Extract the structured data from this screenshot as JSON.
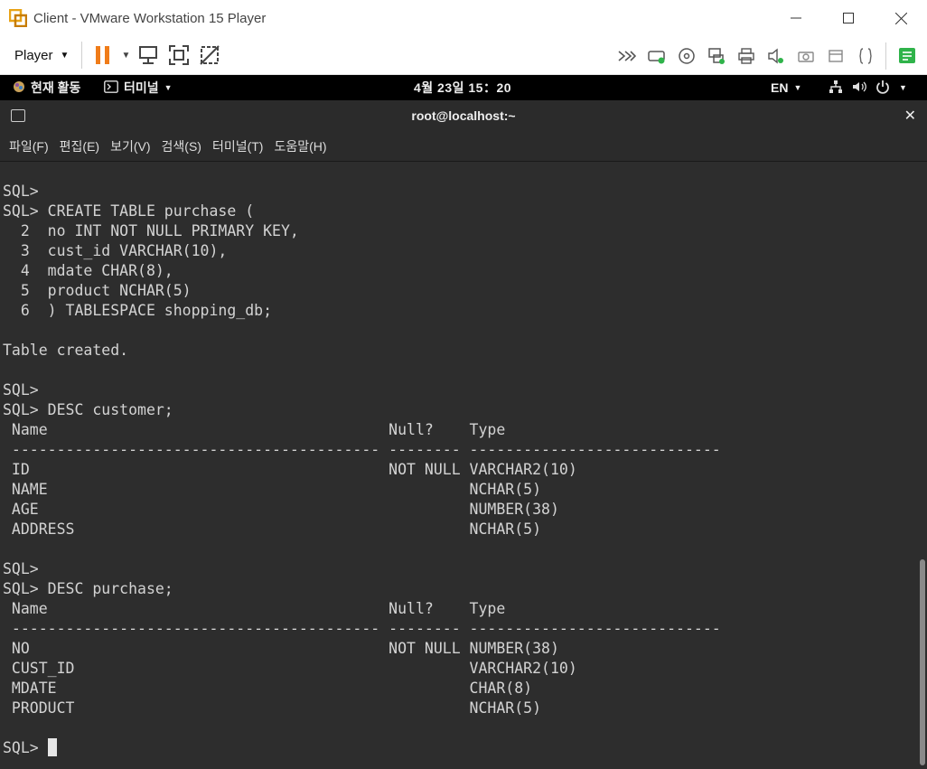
{
  "window": {
    "title": "Client - VMware Workstation 15 Player"
  },
  "toolbar": {
    "player_label": "Player"
  },
  "gnome": {
    "activities": "현재 활동",
    "app_menu": "터미널",
    "clock": "4월 23일  15：20",
    "lang": "EN"
  },
  "terminal": {
    "title": "root@localhost:~",
    "menu": [
      "파일(F)",
      "편집(E)",
      "보기(V)",
      "검색(S)",
      "터미널(T)",
      "도움말(H)"
    ],
    "lines": [
      "SQL>",
      "SQL> CREATE TABLE purchase (",
      "  2  no INT NOT NULL PRIMARY KEY,",
      "  3  cust_id VARCHAR(10),",
      "  4  mdate CHAR(8),",
      "  5  product NCHAR(5)",
      "  6  ) TABLESPACE shopping_db;",
      "",
      "Table created.",
      "",
      "SQL>",
      "SQL> DESC customer;",
      " Name                                      Null?    Type",
      " ----------------------------------------- -------- ----------------------------",
      " ID                                        NOT NULL VARCHAR2(10)",
      " NAME                                               NCHAR(5)",
      " AGE                                                NUMBER(38)",
      " ADDRESS                                            NCHAR(5)",
      "",
      "SQL>",
      "SQL> DESC purchase;",
      " Name                                      Null?    Type",
      " ----------------------------------------- -------- ----------------------------",
      " NO                                        NOT NULL NUMBER(38)",
      " CUST_ID                                            VARCHAR2(10)",
      " MDATE                                              CHAR(8)",
      " PRODUCT                                            NCHAR(5)",
      ""
    ],
    "prompt": "SQL> "
  }
}
